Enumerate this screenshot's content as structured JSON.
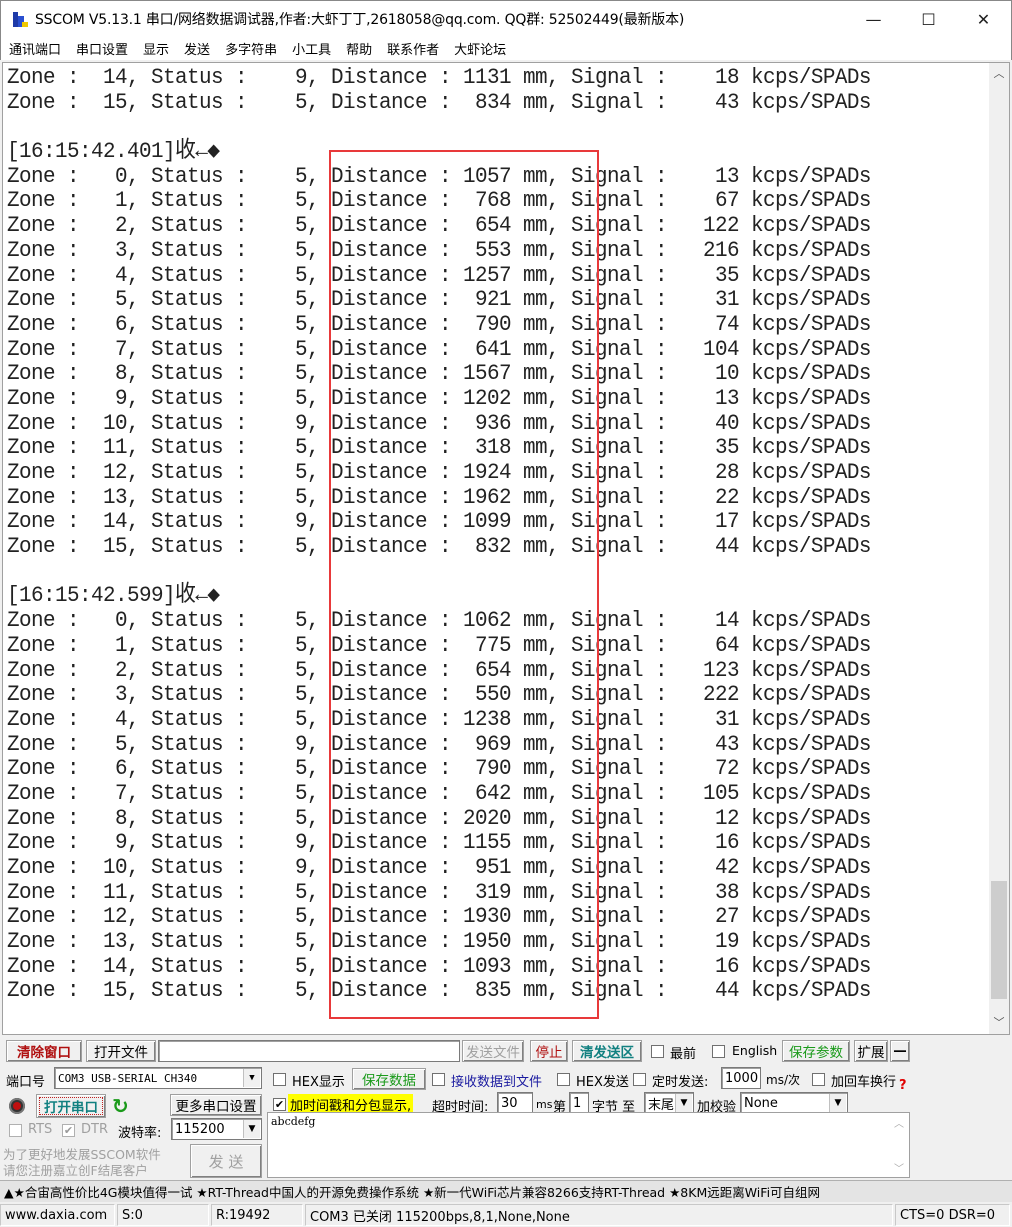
{
  "window": {
    "title": "SSCOM V5.13.1 串口/网络数据调试器,作者:大虾丁丁,2618058@qq.com. QQ群:  52502449(最新版本)",
    "minimize_icon": "minimize-icon",
    "maximize_icon": "maximize-icon",
    "close_icon": "close-icon",
    "minimize_glyph": "—",
    "maximize_glyph": "☐",
    "close_glyph": "✕"
  },
  "menu": [
    "通讯端口",
    "串口设置",
    "显示",
    "发送",
    "多字符串",
    "小工具",
    "帮助",
    "联系作者",
    "大虾论坛"
  ],
  "receive": {
    "lines": [
      "Zone :  14, Status :    9, Distance : 1131 mm, Signal :    18 kcps/SPADs",
      "Zone :  15, Status :    5, Distance :  834 mm, Signal :    43 kcps/SPADs",
      "",
      "[16:15:42.401]收←◆",
      "Zone :   0, Status :    5, Distance : 1057 mm, Signal :    13 kcps/SPADs",
      "Zone :   1, Status :    5, Distance :  768 mm, Signal :    67 kcps/SPADs",
      "Zone :   2, Status :    5, Distance :  654 mm, Signal :   122 kcps/SPADs",
      "Zone :   3, Status :    5, Distance :  553 mm, Signal :   216 kcps/SPADs",
      "Zone :   4, Status :    5, Distance : 1257 mm, Signal :    35 kcps/SPADs",
      "Zone :   5, Status :    5, Distance :  921 mm, Signal :    31 kcps/SPADs",
      "Zone :   6, Status :    5, Distance :  790 mm, Signal :    74 kcps/SPADs",
      "Zone :   7, Status :    5, Distance :  641 mm, Signal :   104 kcps/SPADs",
      "Zone :   8, Status :    5, Distance : 1567 mm, Signal :    10 kcps/SPADs",
      "Zone :   9, Status :    5, Distance : 1202 mm, Signal :    13 kcps/SPADs",
      "Zone :  10, Status :    9, Distance :  936 mm, Signal :    40 kcps/SPADs",
      "Zone :  11, Status :    5, Distance :  318 mm, Signal :    35 kcps/SPADs",
      "Zone :  12, Status :    5, Distance : 1924 mm, Signal :    28 kcps/SPADs",
      "Zone :  13, Status :    5, Distance : 1962 mm, Signal :    22 kcps/SPADs",
      "Zone :  14, Status :    9, Distance : 1099 mm, Signal :    17 kcps/SPADs",
      "Zone :  15, Status :    5, Distance :  832 mm, Signal :    44 kcps/SPADs",
      "",
      "[16:15:42.599]收←◆",
      "Zone :   0, Status :    5, Distance : 1062 mm, Signal :    14 kcps/SPADs",
      "Zone :   1, Status :    5, Distance :  775 mm, Signal :    64 kcps/SPADs",
      "Zone :   2, Status :    5, Distance :  654 mm, Signal :   123 kcps/SPADs",
      "Zone :   3, Status :    5, Distance :  550 mm, Signal :   222 kcps/SPADs",
      "Zone :   4, Status :    5, Distance : 1238 mm, Signal :    31 kcps/SPADs",
      "Zone :   5, Status :    9, Distance :  969 mm, Signal :    43 kcps/SPADs",
      "Zone :   6, Status :    5, Distance :  790 mm, Signal :    72 kcps/SPADs",
      "Zone :   7, Status :    5, Distance :  642 mm, Signal :   105 kcps/SPADs",
      "Zone :   8, Status :    5, Distance : 2020 mm, Signal :    12 kcps/SPADs",
      "Zone :   9, Status :    9, Distance : 1155 mm, Signal :    16 kcps/SPADs",
      "Zone :  10, Status :    9, Distance :  951 mm, Signal :    42 kcps/SPADs",
      "Zone :  11, Status :    5, Distance :  319 mm, Signal :    38 kcps/SPADs",
      "Zone :  12, Status :    5, Distance : 1930 mm, Signal :    27 kcps/SPADs",
      "Zone :  13, Status :    5, Distance : 1950 mm, Signal :    19 kcps/SPADs",
      "Zone :  14, Status :    5, Distance : 1093 mm, Signal :    16 kcps/SPADs",
      "Zone :  15, Status :    5, Distance :  835 mm, Signal :    44 kcps/SPADs"
    ],
    "highlight_color": "#e8393a",
    "scroll_position_fraction": 0.9
  },
  "toolbar": {
    "clear_window": "清除窗口",
    "open_file": "打开文件",
    "file_path": "",
    "send_file": "发送文件",
    "stop": "停止",
    "clear_send": "清发送区",
    "topmost_label": "最前",
    "topmost_checked": false,
    "english_label": "English",
    "english_checked": false,
    "save_params": "保存参数",
    "expand": "扩展",
    "collapse": "—"
  },
  "port": {
    "port_label": "端口号",
    "port_value": "COM3 USB-SERIAL CH340",
    "open_port": "打开串口",
    "more_settings": "更多串口设置",
    "rts_label": "RTS",
    "rts_checked": false,
    "dtr_label": "DTR",
    "dtr_checked": true,
    "baud_label": "波特率:",
    "baud_value": "115200",
    "promo_line1": "为了更好地发展SSCOM软件",
    "promo_line2": "请您注册嘉立创F结尾客户",
    "send_button": "发  送"
  },
  "options": {
    "hex_display_label": "HEX显示",
    "hex_display_checked": false,
    "save_data": "保存数据",
    "recv_to_file_label": "接收数据到文件",
    "recv_to_file_checked": false,
    "hex_send_label": "HEX发送",
    "hex_send_checked": false,
    "timed_send_label": "定时发送:",
    "timed_send_checked": false,
    "interval_value": "1000",
    "interval_unit": "ms/次",
    "add_crlf_label": "加回车换行",
    "add_crlf_checked": false,
    "help_glyph": "?",
    "timestamp_label": "加时间戳和分包显示,",
    "timestamp_checked": true,
    "timeout_label": "超时时间:",
    "timeout_value": "30",
    "timeout_unit": "ms",
    "byte_from_label": "第",
    "byte_from_value": "1",
    "byte_unit_label": "字节 至",
    "byte_to_value": "末尾",
    "checksum_label": "加校验",
    "checksum_value": "None"
  },
  "send_area": {
    "content": "abcdefg"
  },
  "promo_bar": "▲★合宙高性价比4G模块值得一试 ★RT-Thread中国人的开源免费操作系统 ★新一代WiFi芯片兼容8266支持RT-Thread ★8KM远距离WiFi可自组网",
  "statusbar": {
    "website": "www.daxia.com",
    "sent": "S:0",
    "received": "R:19492",
    "port_status": "COM3 已关闭  115200bps,8,1,None,None",
    "lines_status": "CTS=0 DSR=0"
  }
}
